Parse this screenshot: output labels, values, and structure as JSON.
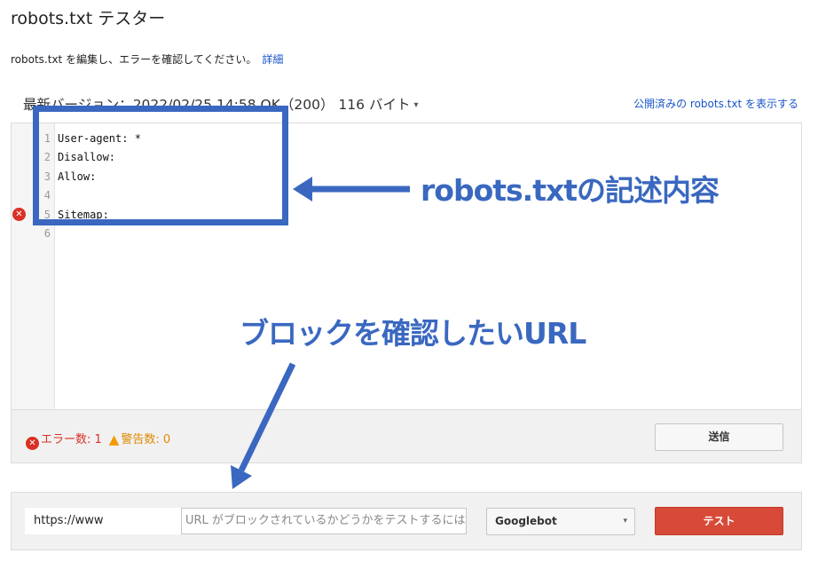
{
  "page": {
    "title": "robots.txt テスター",
    "description": "robots.txt を編集し、エラーを確認してください。",
    "details_link": "詳細"
  },
  "version": {
    "text": "最新バージョン：2022/02/25 14:58 OK（200） 116 バイト",
    "caret": "▾",
    "published_link": "公開済みの robots.txt を表示する"
  },
  "editor": {
    "line_numbers": [
      "1",
      "2",
      "3",
      "4",
      "5",
      "6"
    ],
    "lines": [
      "User-agent: *",
      "Disallow:",
      "Allow:",
      "",
      "Sitemap:",
      ""
    ],
    "error_marker_line": 5
  },
  "status": {
    "errors_label": "エラー数: 1",
    "warnings_label": "警告数: 0",
    "submit_label": "送信"
  },
  "test": {
    "url_prefix": "https://www",
    "url_placeholder": "URL がブロックされているかどうかをテストするには",
    "bot_selected": "Googlebot",
    "test_label": "テスト"
  },
  "annotations": {
    "code_label": "robots.txtの記述内容",
    "url_label": "ブロックを確認したいURL",
    "color": "#3a68c0"
  },
  "colors": {
    "error": "#d93025",
    "warning": "#f29900",
    "link": "#1a55c8",
    "test_button": "#d84a38"
  },
  "icons": {
    "error": "error-icon",
    "warning": "warning-icon"
  }
}
